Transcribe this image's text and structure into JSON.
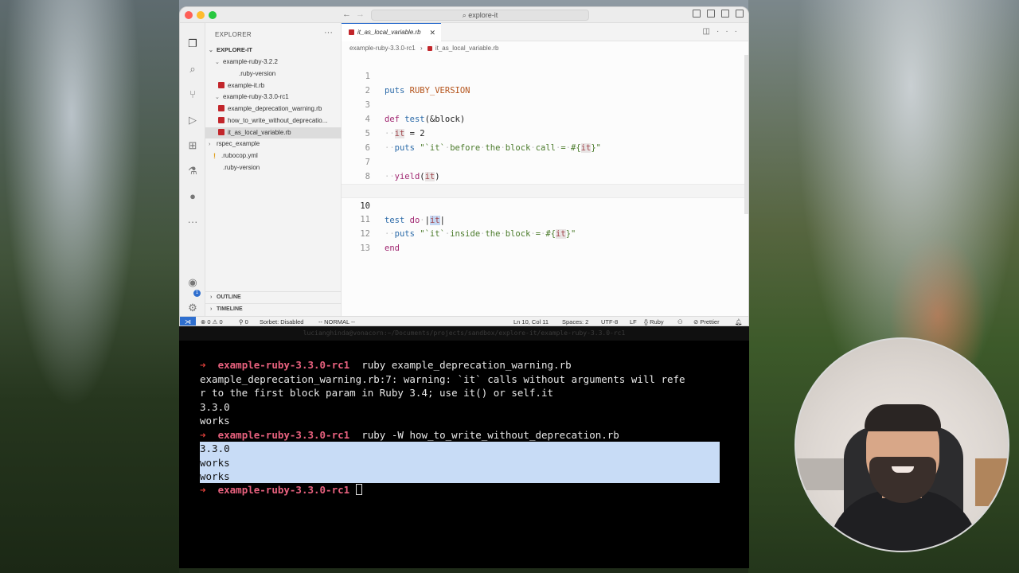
{
  "window": {
    "search_label": "explore-it"
  },
  "activity_bar": {
    "badge": "1"
  },
  "sidebar": {
    "title": "EXPLORER",
    "root": "EXPLORE-IT",
    "items": [
      {
        "label": "example-ruby-3.2.2",
        "kind": "folder"
      },
      {
        "label": ".ruby-version",
        "kind": "file"
      },
      {
        "label": "example-it.rb",
        "kind": "ruby"
      },
      {
        "label": "example-ruby-3.3.0-rc1",
        "kind": "folder"
      },
      {
        "label": "example_deprecation_warning.rb",
        "kind": "ruby"
      },
      {
        "label": "how_to_write_without_deprecatio...",
        "kind": "ruby"
      },
      {
        "label": "it_as_local_variable.rb",
        "kind": "ruby"
      },
      {
        "label": "rspec_example",
        "kind": "folder-closed"
      },
      {
        "label": ".rubocop.yml",
        "kind": "yml"
      },
      {
        "label": ".ruby-version",
        "kind": "file"
      }
    ],
    "outline": "OUTLINE",
    "timeline": "TIMELINE"
  },
  "editor": {
    "tab_label": "it_as_local_variable.rb",
    "breadcrumb": [
      "example-ruby-3.3.0-rc1",
      "it_as_local_variable.rb"
    ],
    "line_numbers": [
      "1",
      "2",
      "3",
      "4",
      "5",
      "6",
      "7",
      "8",
      "9",
      "10",
      "11",
      "12",
      "13"
    ],
    "current_line": "10"
  },
  "statusbar": {
    "problems": "0",
    "warnings": "0",
    "ports": "0",
    "sorbet": "Sorbet: Disabled",
    "mode": "-- NORMAL --",
    "position": "Ln 10, Col 11",
    "spaces": "Spaces: 2",
    "encoding": "UTF-8",
    "eol": "LF",
    "language": "Ruby",
    "formatter": "Prettier"
  },
  "terminal": {
    "title": "lucianghinda@vonacorn:~/Documents/projects/sandbox/explore-it/example-ruby-3.3.0-rc1",
    "prompt_dir": "example-ruby-3.3.0-rc1",
    "cmd1": "ruby example_deprecation_warning.rb",
    "warn1": "example_deprecation_warning.rb:7: warning: `it` calls without arguments will refe",
    "warn2": "r to the first block param in Ruby 3.4; use it() or self.it",
    "out1": "3.3.0",
    "out2": "works",
    "cmd2": "ruby -W how_to_write_without_deprecation.rb",
    "sel1": "3.3.0",
    "sel2": "works",
    "sel3": "works"
  }
}
